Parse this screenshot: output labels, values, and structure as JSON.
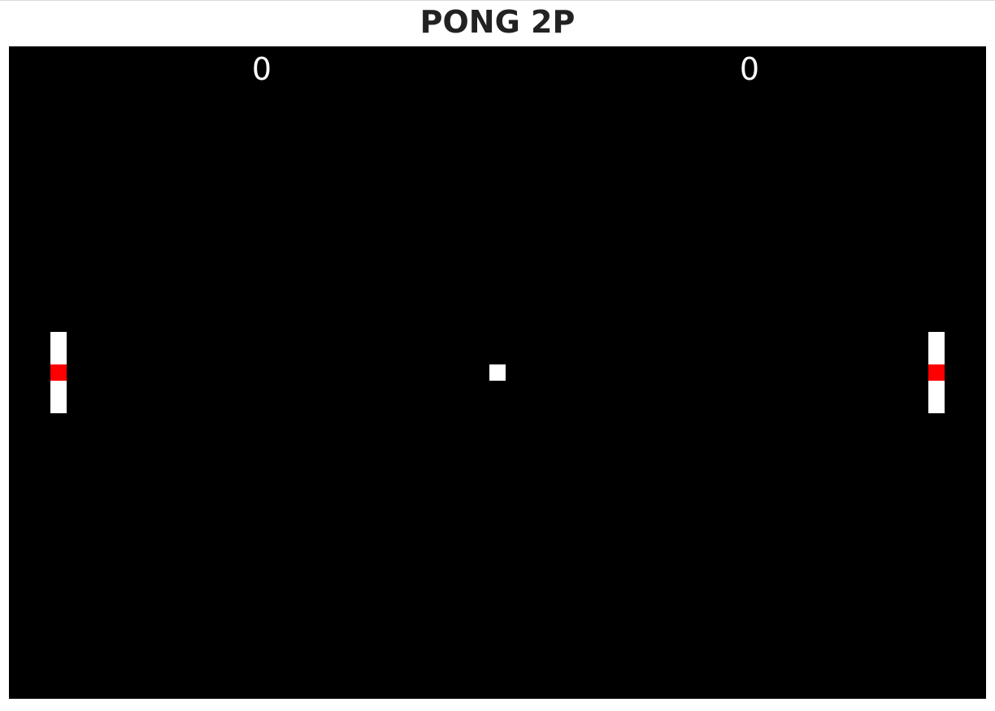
{
  "header": {
    "title": "PONG 2P"
  },
  "scoreboard": {
    "left_score": "0",
    "right_score": "0"
  },
  "colors": {
    "court": "#000000",
    "paddle": "#ffffff",
    "paddle_core": "#ff0000",
    "ball": "#ffffff"
  }
}
